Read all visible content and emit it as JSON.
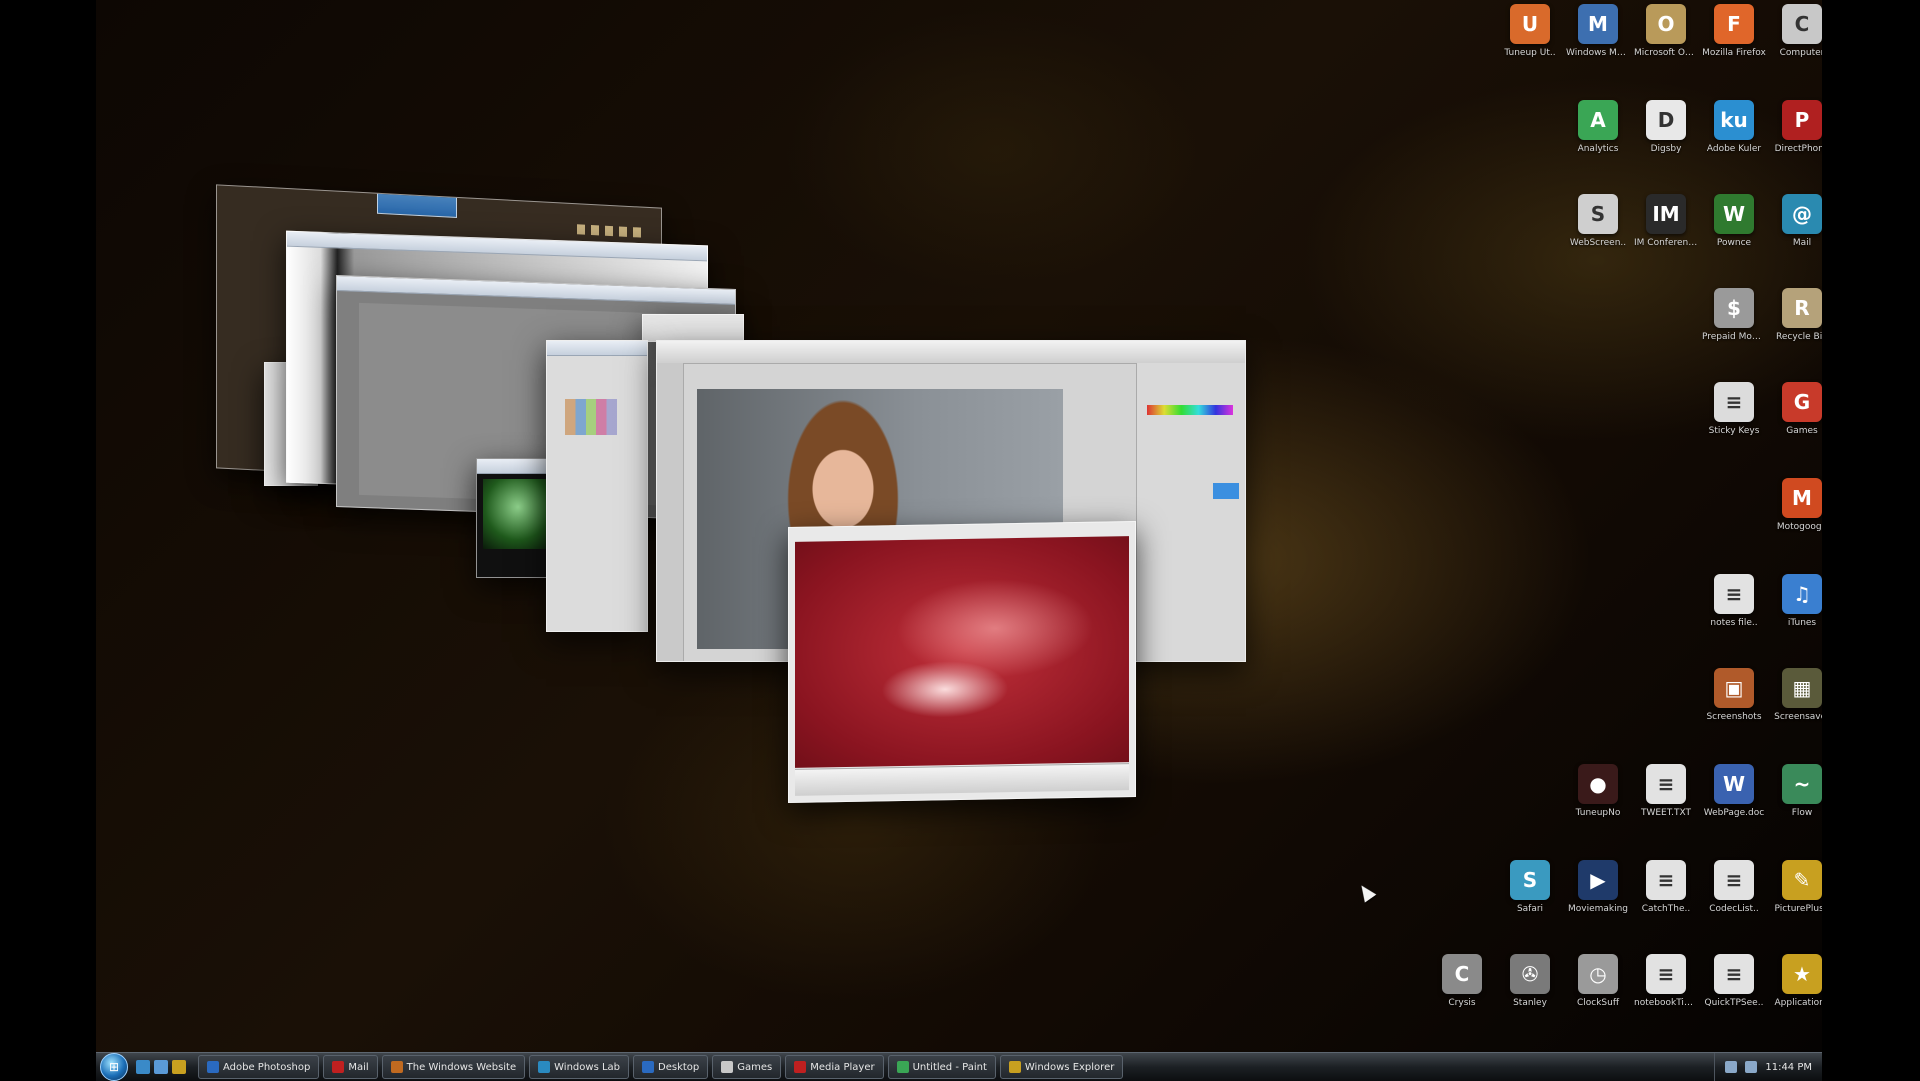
{
  "desktop_icons": [
    {
      "id": "r1c1",
      "label": "Tuneup Ut..",
      "glyph": "U",
      "icon": "tuneup-icon",
      "color": "#d96a2b"
    },
    {
      "id": "r1c2",
      "label": "Windows Movie Maker",
      "glyph": "M",
      "icon": "movie-maker-icon",
      "color": "#3d6fb0"
    },
    {
      "id": "r1c3",
      "label": "Microsoft Office Coll..",
      "glyph": "O",
      "icon": "office-icon",
      "color": "#b99a5a"
    },
    {
      "id": "r1c4",
      "label": "Mozilla Firefox",
      "glyph": "F",
      "icon": "firefox-icon",
      "color": "#e0662a"
    },
    {
      "id": "r1c5",
      "label": "Computer",
      "glyph": "C",
      "icon": "computer-icon",
      "color": "#c8c8c8"
    },
    {
      "id": "r2c1",
      "label": "Analytics",
      "glyph": "A",
      "icon": "analytics-icon",
      "color": "#3aa655"
    },
    {
      "id": "r2c2",
      "label": "Digsby",
      "glyph": "D",
      "icon": "digsby-icon",
      "color": "#e8e8e8"
    },
    {
      "id": "r2c3",
      "label": "Adobe Kuler",
      "glyph": "ku",
      "icon": "kuler-icon",
      "color": "#2b8fd1"
    },
    {
      "id": "r2c4",
      "label": "DirectPhone",
      "glyph": "P",
      "icon": "phone-icon",
      "color": "#b02020"
    },
    {
      "id": "r3c1",
      "label": "WebScreen..",
      "glyph": "S",
      "icon": "camera-icon",
      "color": "#cfcfcf"
    },
    {
      "id": "r3c2",
      "label": "IM Conference",
      "glyph": "IM",
      "icon": "im-icon",
      "color": "#2a2a2a"
    },
    {
      "id": "r3c3",
      "label": "Pownce",
      "glyph": "W",
      "icon": "pownce-icon",
      "color": "#2f7a2f"
    },
    {
      "id": "r3c4",
      "label": "Mail",
      "glyph": "@",
      "icon": "globe-icon",
      "color": "#2a8ab0"
    },
    {
      "id": "r4c1",
      "label": "Prepaid Mobile Stock Pit..",
      "glyph": "$",
      "icon": "orb-icon",
      "color": "#9a9a9a"
    },
    {
      "id": "r4c2",
      "label": "Recycle Bin",
      "glyph": "R",
      "icon": "recycle-bin-icon",
      "color": "#b5a27a"
    },
    {
      "id": "r5c1",
      "label": "Sticky Keys",
      "glyph": "≡",
      "icon": "document-icon",
      "color": "#dcdcdc"
    },
    {
      "id": "r5c2",
      "label": "Games",
      "glyph": "G",
      "icon": "games-icon",
      "color": "#c83a2a"
    },
    {
      "id": "r6c2",
      "label": "Motogoogo",
      "glyph": "M",
      "icon": "bike-icon",
      "color": "#d04a20"
    },
    {
      "id": "r7c1",
      "label": "notes file..",
      "glyph": "≡",
      "icon": "document-icon",
      "color": "#e2e2e2"
    },
    {
      "id": "r7c2",
      "label": "iTunes",
      "glyph": "♫",
      "icon": "itunes-icon",
      "color": "#3a7fd0"
    },
    {
      "id": "r8c1",
      "label": "Screenshots",
      "glyph": "▣",
      "icon": "screenshot-icon",
      "color": "#b05a2a"
    },
    {
      "id": "r8c2",
      "label": "Screensaver",
      "glyph": "▦",
      "icon": "screensaver-icon",
      "color": "#5a5a3a"
    },
    {
      "id": "r9c1",
      "label": "TuneupNo",
      "glyph": "●",
      "icon": "tuneup-dot-icon",
      "color": "#3a1a1a"
    },
    {
      "id": "r9c2",
      "label": "TWEET.TXT",
      "glyph": "≡",
      "icon": "text-file-icon",
      "color": "#e2e2e2"
    },
    {
      "id": "r9c3",
      "label": "WebPage.doc",
      "glyph": "W",
      "icon": "word-doc-icon",
      "color": "#3a62b0"
    },
    {
      "id": "r9c4",
      "label": "Flow",
      "glyph": "~",
      "icon": "flow-icon",
      "color": "#3a8a5a"
    },
    {
      "id": "r10c1",
      "label": "Safari",
      "glyph": "S",
      "icon": "safari-icon",
      "color": "#3a9ac0"
    },
    {
      "id": "r10c2",
      "label": "Moviemaking",
      "glyph": "▶",
      "icon": "movie-icon",
      "color": "#1f3a6a"
    },
    {
      "id": "r10c3",
      "label": "CatchThe..",
      "glyph": "≡",
      "icon": "document-icon",
      "color": "#e2e2e2"
    },
    {
      "id": "r10c4",
      "label": "CodecList..",
      "glyph": "≡",
      "icon": "document-icon",
      "color": "#e2e2e2"
    },
    {
      "id": "r10c5",
      "label": "PicturePlus..",
      "glyph": "✎",
      "icon": "picture-icon",
      "color": "#c8a020"
    },
    {
      "id": "r11c1",
      "label": "Crysis",
      "glyph": "C",
      "icon": "crysis-icon",
      "color": "#8a8a8a"
    },
    {
      "id": "r11c2",
      "label": "Stanley",
      "glyph": "✇",
      "icon": "film-reel-icon",
      "color": "#7a7a7a"
    },
    {
      "id": "r11c3",
      "label": "ClockSuff",
      "glyph": "◷",
      "icon": "clock-icon",
      "color": "#9a9a9a"
    },
    {
      "id": "r11c4",
      "label": "notebookTips..",
      "glyph": "≡",
      "icon": "document-icon",
      "color": "#e2e2e2"
    },
    {
      "id": "r11c5",
      "label": "QuickTPSee..",
      "glyph": "≡",
      "icon": "document-icon",
      "color": "#e2e2e2"
    },
    {
      "id": "r11c6",
      "label": "Applications",
      "glyph": "★",
      "icon": "applications-icon",
      "color": "#c8a020"
    }
  ],
  "taskbar": {
    "start_label": "⊞",
    "tasks": [
      {
        "label": "Adobe Photoshop",
        "color": "#2a6ac0"
      },
      {
        "label": "Mail",
        "color": "#c02020"
      },
      {
        "label": "The Windows Website",
        "color": "#c06a20"
      },
      {
        "label": "Windows Lab",
        "color": "#2a8ac0"
      },
      {
        "label": "Desktop",
        "color": "#2a6ac0"
      },
      {
        "label": "Games",
        "color": "#c8c8c8"
      },
      {
        "label": "Media Player",
        "color": "#c02020"
      },
      {
        "label": "Untitled - Paint",
        "color": "#3aa655"
      },
      {
        "label": "Windows Explorer",
        "color": "#c8a020"
      }
    ],
    "clock": "11:44 PM"
  }
}
